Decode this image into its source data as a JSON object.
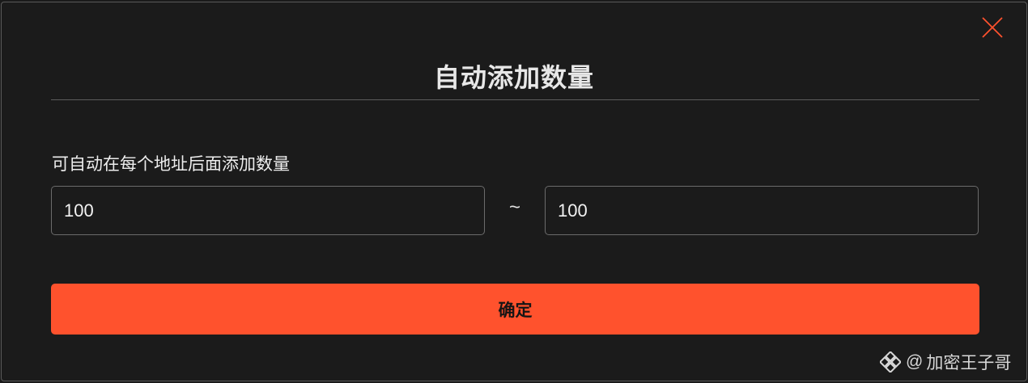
{
  "dialog": {
    "title": "自动添加数量",
    "description": "可自动在每个地址后面添加数量",
    "min_value": "100",
    "separator": "~",
    "max_value": "100",
    "confirm_label": "确定"
  },
  "icons": {
    "close": "close-icon",
    "watermark_logo": "diamond-logo-icon"
  },
  "watermark": {
    "at": "@",
    "author": "加密王子哥"
  },
  "colors": {
    "background": "#1b1b1b",
    "accent": "#ff522d",
    "border": "#6b6b6b",
    "text": "#ededed"
  }
}
